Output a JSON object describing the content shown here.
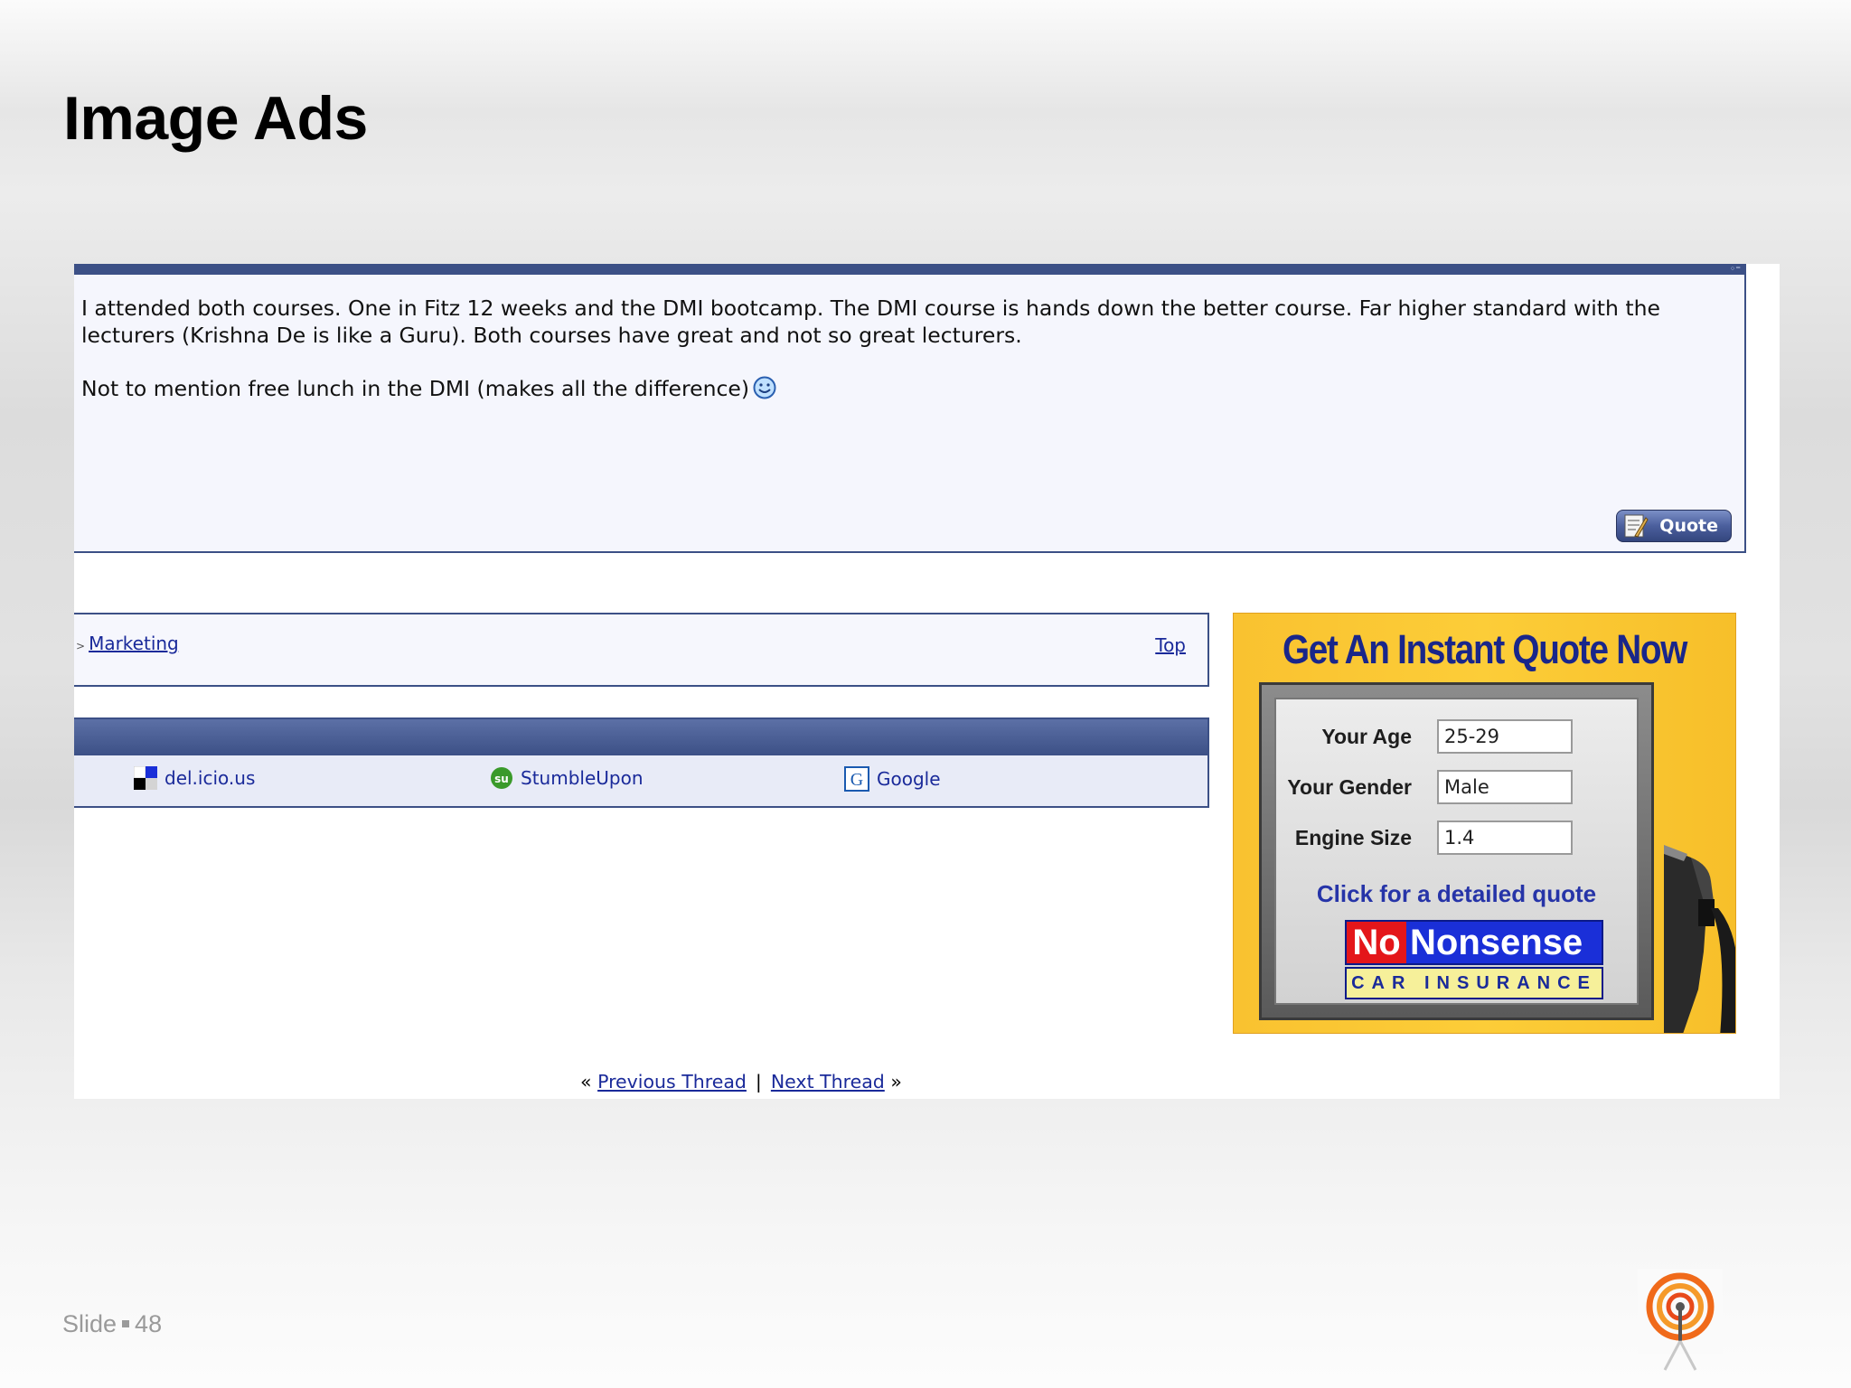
{
  "slide": {
    "title": "Image Ads",
    "footer_label": "Slide",
    "slide_number": "48"
  },
  "post": {
    "paragraph1": "I attended both courses. One in Fitz 12 weeks and the DMI bootcamp. The DMI course is hands down the better course. Far higher standard with the lecturers (Krishna De is like a Guru). Both courses have great and not so great lecturers.",
    "paragraph2": "Not to mention free lunch in the DMI (makes all the difference)",
    "quote_button": "Quote"
  },
  "navigation": {
    "breadcrumb": "Marketing",
    "top_link": "Top"
  },
  "social": {
    "items": [
      {
        "label": "del.icio.us",
        "icon": "delicious-icon"
      },
      {
        "label": "StumbleUpon",
        "icon": "stumbleupon-icon"
      },
      {
        "label": "Google",
        "icon": "google-icon"
      }
    ]
  },
  "ad": {
    "headline": "Get An Instant Quote Now",
    "fields": [
      {
        "label": "Your Age",
        "value": "25-29"
      },
      {
        "label": "Your Gender",
        "value": "Male"
      },
      {
        "label": "Engine Size",
        "value": "1.4"
      }
    ],
    "cta": "Click for a detailed quote",
    "brand_no": "No",
    "brand_name": "Nonsense",
    "brand_tagline": "CAR INSURANCE",
    "colors": {
      "background": "#fcca34",
      "headline": "#19268a",
      "brand_red": "#e4161a",
      "brand_blue": "#1a2fd8"
    }
  },
  "thread_nav": {
    "previous": "Previous Thread",
    "separator": "|",
    "next": "Next Thread"
  },
  "colors": {
    "forum_border": "#3c5086",
    "link": "#1a2a9a"
  }
}
